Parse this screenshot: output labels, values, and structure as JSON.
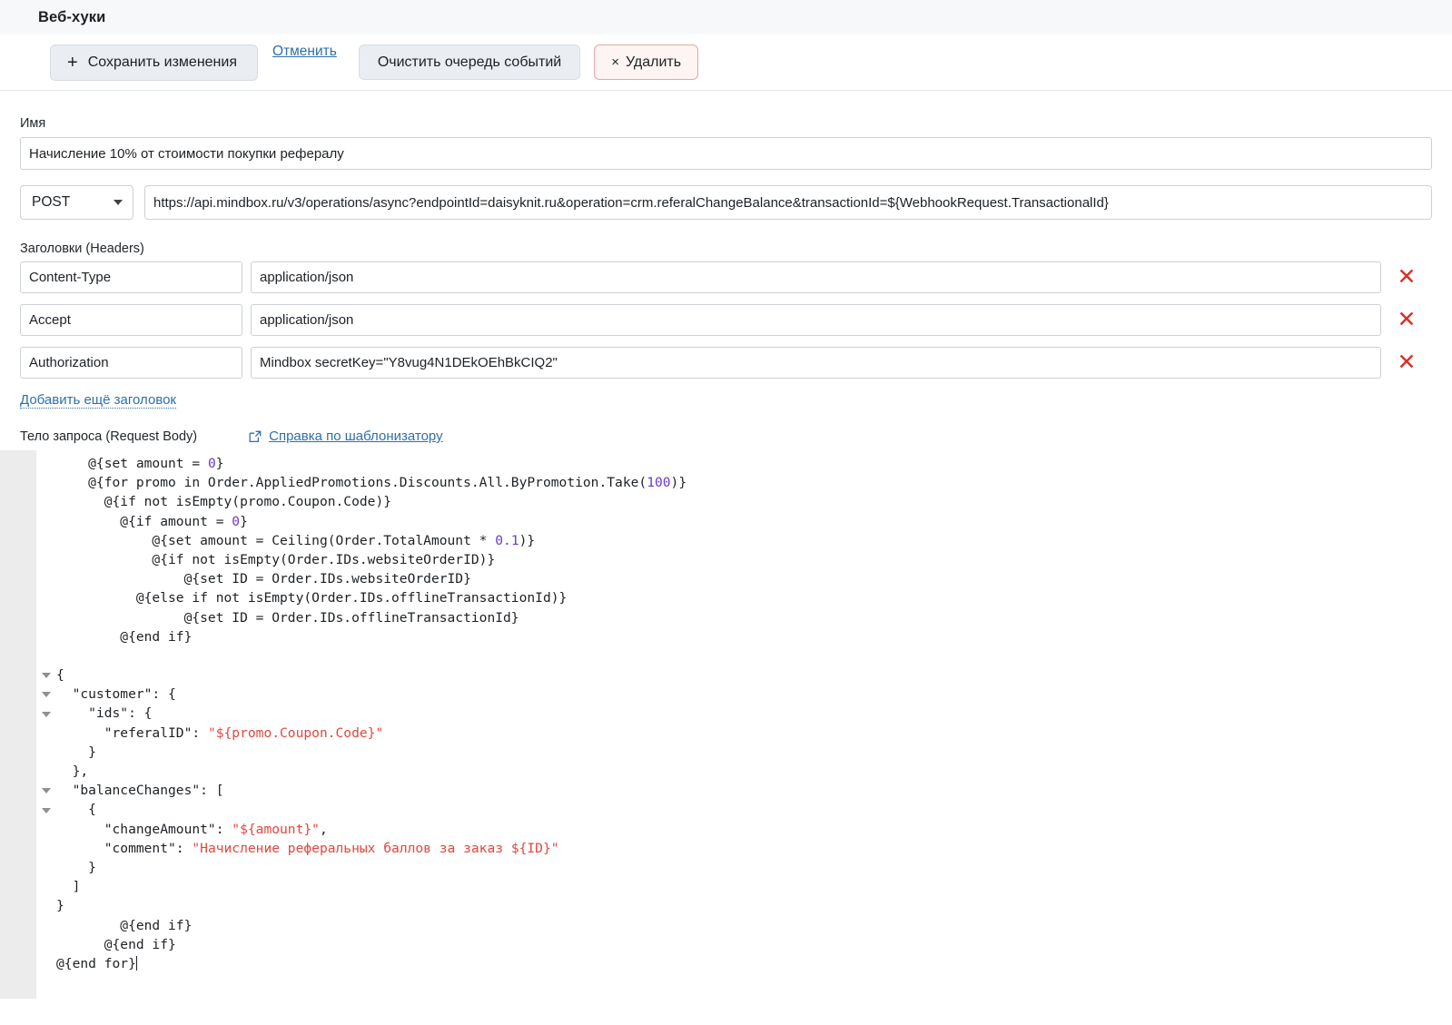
{
  "header": {
    "title": "Веб-хуки"
  },
  "toolbar": {
    "save_label": "Сохранить изменения",
    "save_icon": "plus-icon",
    "cancel_label": "Отменить",
    "clear_queue_label": "Очистить очередь событий",
    "delete_label": "Удалить",
    "delete_icon": "x-icon"
  },
  "form": {
    "name_label": "Имя",
    "name_value": "Начисление 10% от стоимости покупки рефералу",
    "method_value": "POST",
    "url_value": "https://api.mindbox.ru/v3/operations/async?endpointId=daisyknit.ru&operation=crm.referalChangeBalance&transactionId=${WebhookRequest.TransactionalId}"
  },
  "headers_section": {
    "label": "Заголовки (Headers)",
    "rows": [
      {
        "key": "Content-Type",
        "value": "application/json",
        "delete_icon": "close-icon"
      },
      {
        "key": "Accept",
        "value": "application/json",
        "delete_icon": "close-icon"
      },
      {
        "key": "Authorization",
        "value": "Mindbox secretKey=\"Y8vug4N1DEkOEhBkCIQ2\"",
        "delete_icon": "close-icon"
      }
    ],
    "add_link": "Добавить ещё заголовок"
  },
  "body_section": {
    "label": "Тело запроса (Request Body)",
    "help_link": "Справка по шаблонизатору",
    "help_icon": "external-link-icon"
  },
  "code": {
    "lines": [
      {
        "indent": 2,
        "text": "@{set amount = ",
        "num": "0",
        "tail": "}"
      },
      {
        "indent": 2,
        "text": "@{for promo in Order.AppliedPromotions.Discounts.All.ByPromotion.Take(",
        "num": "100",
        "tail": ")}"
      },
      {
        "indent": 3,
        "text": "@{if not isEmpty(promo.Coupon.Code)}"
      },
      {
        "indent": 4,
        "text": "@{if amount = ",
        "num": "0",
        "tail": "}"
      },
      {
        "indent": 6,
        "text": "@{set amount = Ceiling(Order.TotalAmount * ",
        "num": "0.1",
        "tail": ")}"
      },
      {
        "indent": 6,
        "text": "@{if not isEmpty(Order.IDs.websiteOrderID)}"
      },
      {
        "indent": 8,
        "text": "@{set ID = Order.IDs.websiteOrderID}"
      },
      {
        "indent": 5,
        "text": "@{else if not isEmpty(Order.IDs.offlineTransactionId)}"
      },
      {
        "indent": 8,
        "text": "@{set ID = Order.IDs.offlineTransactionId}"
      },
      {
        "indent": 4,
        "text": "@{end if}"
      },
      {
        "indent": 0,
        "text": ""
      },
      {
        "indent": 0,
        "text": "{",
        "fold": true
      },
      {
        "indent": 1,
        "text": "\"customer\": {",
        "fold": true
      },
      {
        "indent": 2,
        "text": "\"ids\": {",
        "fold": true
      },
      {
        "indent": 3,
        "text": "\"referalID\": ",
        "str": "\"${promo.Coupon.Code}\""
      },
      {
        "indent": 2,
        "text": "}"
      },
      {
        "indent": 1,
        "text": "},"
      },
      {
        "indent": 1,
        "text": "\"balanceChanges\": [",
        "fold": true
      },
      {
        "indent": 2,
        "text": "{",
        "fold": true
      },
      {
        "indent": 3,
        "text": "\"changeAmount\": ",
        "str": "\"${amount}\"",
        "tail": ","
      },
      {
        "indent": 3,
        "text": "\"comment\": ",
        "str": "\"Начисление реферальных баллов за заказ ${ID}\""
      },
      {
        "indent": 2,
        "text": "}"
      },
      {
        "indent": 1,
        "text": "]"
      },
      {
        "indent": 0,
        "text": "}"
      },
      {
        "indent": 4,
        "text": "@{end if}"
      },
      {
        "indent": 3,
        "text": "@{end if}"
      },
      {
        "indent": 0,
        "text": "@{end for}",
        "caret": true
      }
    ]
  },
  "colors": {
    "link": "#2f6fa8",
    "delete_red": "#d93025",
    "string_red": "#e0483e",
    "number_purple": "#6a39cc",
    "button_bg": "#eaeef3",
    "delete_button_bg": "#fdf4f3"
  }
}
